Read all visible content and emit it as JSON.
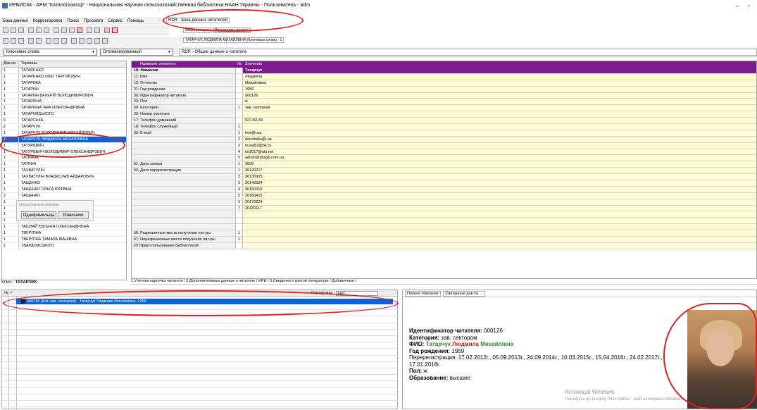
{
  "window": {
    "title": "ИРБИС64 - АРМ \"Каталогизатор\" - Национальная научная сельскохозяйственная библиотека НААН Украины - Пользователь - adm"
  },
  "menu": [
    "База данных",
    "Корректировка",
    "Поиск",
    "Просмотр",
    "Сервис",
    "Помощь"
  ],
  "db_tab": "RDR - База данных читателей",
  "right_top_tabs": [
    "Информация",
    "Результаты поиска"
  ],
  "search_result_label": "ТАТАРЧУК ЛЮДМИЛА МИХАЙЛІВНА (Ключевые слова) - 1",
  "filters": {
    "mode": "Ключевые слова",
    "optimized": "Оптимизированный",
    "rdr_label": "RDR - Общие данные о читателе"
  },
  "terms_table": {
    "headers": [
      "Док-ов",
      "Термины"
    ],
    "rows": [
      {
        "count": "1",
        "term": "ТАТАРЕНКО"
      },
      {
        "count": "1",
        "term": "ТАТАРЕНКО ОЛЕГ ГЕРГІЙОВИЧ"
      },
      {
        "count": "1",
        "term": "ТАТАРИКА"
      },
      {
        "count": "1",
        "term": "ТАТАРИН"
      },
      {
        "count": "1",
        "term": "ТАТАРИН ВАЛЕРІЙ ВОЛОДИМИРОВИЧ"
      },
      {
        "count": "1",
        "term": "ТАТАРКІНА"
      },
      {
        "count": "1",
        "term": "ТАТАРКІНА ЯНА ОЛЕКСАНДРІВНА"
      },
      {
        "count": "1",
        "term": "ТАТАРОВСЬКОГО"
      },
      {
        "count": "6",
        "term": "ТАТАРСЬКА"
      },
      {
        "count": "2",
        "term": "ТАТАРЧУК"
      },
      {
        "count": "1",
        "term": "ТАТАРЧУК ВОЛОДИМИР МИХАЙЛОВИЧ"
      },
      {
        "count": "1",
        "term": "ТАТАРЧУК ЛЮДМИЛА МИХАЙЛІВНА",
        "selected": true
      },
      {
        "count": "1",
        "term": "ТАТУРЕВИЧ"
      },
      {
        "count": "1",
        "term": "ТАТУРЕВИЧ ВОЛОДИМИР ОЛЕКСАНДРОВИЧ"
      },
      {
        "count": "1",
        "term": "ТАТЬЯНА"
      },
      {
        "count": "1",
        "term": "ТАТЯНА"
      },
      {
        "count": "1",
        "term": "ТАХВАТУЛІН"
      },
      {
        "count": "1",
        "term": "ТАХВАТУЛІН ВЛАДИСЛАВ АЙДАРОВИЧ"
      },
      {
        "count": "1",
        "term": "ТАЩЕНКО"
      },
      {
        "count": "1",
        "term": "ТАЩЕНКО ОЛЬГА ЮРІЇВНА"
      },
      {
        "count": "2",
        "term": "ТАЩЕНКО"
      },
      {
        "count": "1",
        "term": "ТАЩЕНКО ЮЛІЯ ОЛЕКСАНДРІВНА"
      },
      {
        "count": "1",
        "term": "ТАШЕВА ЮЛІЯ ВАСИЛІВНА"
      },
      {
        "count": "1",
        "term": "ТАШКЕНТСЬКА"
      },
      {
        "count": "1",
        "term": "ТАШЛАЙ"
      },
      {
        "count": "1",
        "term": "ТАШЛАЙ ЄВГЕНІЯ ОЛЕКСАНДРІВНА"
      },
      {
        "count": "1",
        "term": "ТВЕРІТІНА"
      },
      {
        "count": "1",
        "term": "ТВЕРІТІНА ТАМАРА ІВАНІВНА"
      },
      {
        "count": "1",
        "term": "ТВАРДОВСЬКОГО"
      }
    ]
  },
  "popup": {
    "title": "Оперативные режимы",
    "btn1": "Однофамильцы",
    "btn2": "Ровесники"
  },
  "key": {
    "label": "Ключ:",
    "value": "ТАТАРЧУК"
  },
  "record_grid": {
    "headers": [
      "Название элемента",
      "№",
      "Значение"
    ],
    "rows": [
      {
        "name": "10: Фамилия",
        "n": "",
        "value": "Татарчук"
      },
      {
        "name": "11: Имя",
        "n": "",
        "value": "Людмила"
      },
      {
        "name": "12: Отчество",
        "n": "",
        "value": "Михайлівна"
      },
      {
        "name": "21: Год рождения",
        "n": "",
        "value": "1959"
      },
      {
        "name": "30: Идентификатор читателя",
        "n": "",
        "value": "000126"
      },
      {
        "name": "23: Пол",
        "n": "",
        "value": "ж"
      },
      {
        "name": "50: Категория",
        "n": "1",
        "value": "зав. сектором"
      },
      {
        "name": "22: Номер пропуска",
        "n": "",
        "value": ""
      },
      {
        "name": "17: Телефон домашний",
        "n": "",
        "value": "527-82-84"
      },
      {
        "name": "18: Телефон служебный",
        "n": "1",
        "value": ""
      },
      {
        "name": "32: E-mail",
        "n": "1",
        "value": "levr@i.ua"
      },
      {
        "name": "",
        "n": "2",
        "value": "doremefa@i.ua"
      },
      {
        "name": "",
        "n": "3",
        "value": "irusia82@bk.ru"
      },
      {
        "name": "",
        "n": "4",
        "value": "tm2017@ukr.net"
      },
      {
        "name": "",
        "n": "5",
        "value": "admin@dnsgb.com.ua"
      },
      {
        "name": "51: Дата записи",
        "n": "1",
        "value": "2009"
      },
      {
        "name": "52: Дата перерегистрации",
        "n": "1",
        "value": "20120217"
      },
      {
        "name": "",
        "n": "2",
        "value": "20130905"
      },
      {
        "name": "",
        "n": "3",
        "value": "20140924"
      },
      {
        "name": "",
        "n": "4",
        "value": "20150310"
      },
      {
        "name": "",
        "n": "5",
        "value": "20160415"
      },
      {
        "name": "",
        "n": "6",
        "value": "20170224"
      },
      {
        "name": "",
        "n": "7",
        "value": "20180117"
      },
      {
        "name": "",
        "n": "",
        "value": ""
      },
      {
        "name": "",
        "n": "",
        "value": ""
      },
      {
        "name": "",
        "n": "",
        "value": ""
      },
      {
        "name": "56: Разрешенные места получения лит-ры",
        "n": "1",
        "value": ""
      },
      {
        "name": "57: Неразрешенные места получения лит-ры",
        "n": "1",
        "value": ""
      },
      {
        "name": "29 Право пользования библиотекой",
        "n": "",
        "value": ""
      }
    ]
  },
  "subtabs": "1.Учетная карточка читателя / 2.Дополнительные данные о читателе / ИРИ / 3.Сведения о взятой литературе / Добавочные /",
  "bottom_list": {
    "header_no": "№",
    "sort_label": "Сортировка",
    "sort_value": "Нет",
    "selected_row": "000126 (Кат. зав. сектором) - Татарчук Людмила Михайлівна, 1959"
  },
  "desc_tabs": [
    "Полное описание",
    "Связанные док-ты ..."
  ],
  "description": {
    "id_label": "Идентификатор читателя:",
    "id_value": "000126",
    "cat_label": "Категория:",
    "cat_value": "зав. сектором",
    "fio_label": "ФИО:",
    "surname": "Татарчук",
    "name": "Людмила",
    "patronymic": "Михайлівна",
    "year_label": "Год рождения:",
    "year_value": "1959",
    "rereg": "Перерегистрация: 17.02.2012г., 05.09.2013г., 24.09.2014г., 10.03.2015г., 15.04.2016г., 24.02.2017г., 17.01.2018г.",
    "sex_label": "Пол:",
    "sex_value": "ж",
    "edu_label": "Образование:",
    "edu_value": "высшее"
  },
  "watermark": {
    "line1": "Активація Windows",
    "line2": "Перейдіть до розділу \"Настройки\", щоб активувати Windows."
  },
  "accent_colors": {
    "selection": "#0a64d8",
    "record_header": "#7b1c8c",
    "value_bg": "#fffbd2",
    "annotation": "#e02020"
  }
}
